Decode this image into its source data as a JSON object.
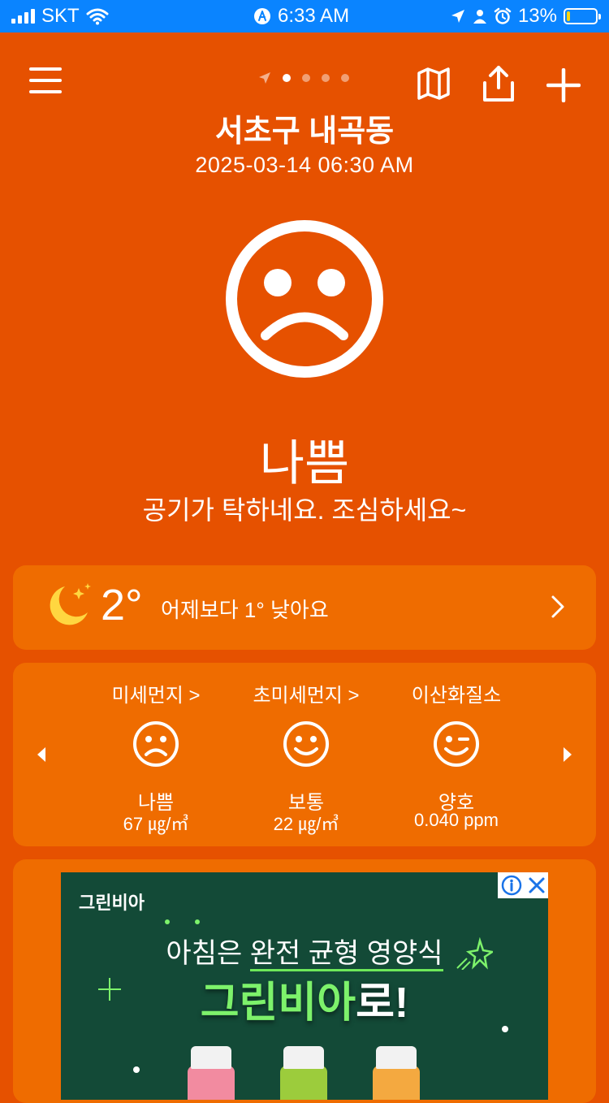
{
  "status_bar": {
    "carrier": "SKT",
    "time": "6:33 AM",
    "battery_percent": "13%",
    "battery_level": 0.13
  },
  "header": {
    "location": "서초구 내곡동",
    "datetime": "2025-03-14 06:30 AM",
    "page_indicator": {
      "count": 4,
      "active_index": 0
    }
  },
  "overall": {
    "grade": "나쁨",
    "message": "공기가 탁하네요. 조심하세요~",
    "face": "sad-face-icon"
  },
  "weather": {
    "temperature": "2°",
    "comparison": "어제보다 1° 낮아요"
  },
  "air_items": [
    {
      "name": "미세먼지 >",
      "grade": "나쁨",
      "value": "67 ㎍/㎥",
      "face": "sad-face-icon"
    },
    {
      "name": "초미세먼지 >",
      "grade": "보통",
      "value": "22 ㎍/㎥",
      "face": "smile-face-icon"
    },
    {
      "name": "이산화질소",
      "grade": "양호",
      "value": "0.040 ppm",
      "face": "wink-face-icon"
    }
  ],
  "ad": {
    "brand_small": "그린비아",
    "headline_prefix": "아침은 ",
    "headline_underlined": "완전 균형 영양식",
    "brand_big": "그린비아",
    "brand_suffix": "로!"
  },
  "colors": {
    "background": "#E65100",
    "card": "#EF6C00",
    "status_bar": "#0a84ff",
    "ad_background": "#134a37",
    "ad_accent": "#7df26b"
  }
}
